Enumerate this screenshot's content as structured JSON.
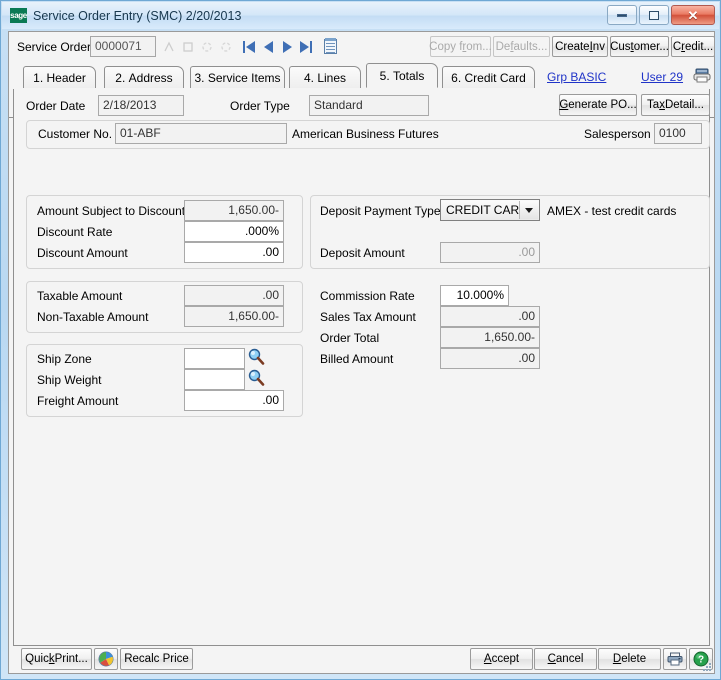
{
  "window": {
    "title": "Service Order Entry (SMC) 2/20/2013",
    "logo_text": "sage",
    "buttons": {
      "minimize": "minimize-button",
      "maximize": "maximize-button",
      "close": "close-button",
      "close_glyph": "✕"
    }
  },
  "toolbar": {
    "service_order_label": "Service Order",
    "service_order_value": "0000071",
    "nav": {
      "first": "first-record-icon",
      "prev": "previous-record-icon",
      "next": "next-record-icon",
      "last": "last-record-icon",
      "memo": "memo-icon"
    },
    "buttons": [
      {
        "label": "Copy from...",
        "mnemonic": "f",
        "enabled": false,
        "name": "copy-from-button"
      },
      {
        "label": "Defaults...",
        "mnemonic": "f",
        "enabled": false,
        "name": "defaults-button"
      },
      {
        "label": "Create Inv",
        "mnemonic": "I",
        "enabled": true,
        "name": "create-inv-button"
      },
      {
        "label": "Customer...",
        "mnemonic": "t",
        "enabled": true,
        "name": "customer-button"
      },
      {
        "label": "Credit...",
        "mnemonic": "r",
        "enabled": true,
        "name": "credit-button"
      }
    ]
  },
  "tabs": [
    {
      "num": "1.",
      "label": "Header",
      "active": false
    },
    {
      "num": "2.",
      "label": "Address",
      "active": false
    },
    {
      "num": "3.",
      "label": "Service Items",
      "active": false
    },
    {
      "num": "4.",
      "label": "Lines",
      "active": false
    },
    {
      "num": "5.",
      "label": "Totals",
      "active": true
    },
    {
      "num": "6.",
      "label": "Credit Card",
      "active": false
    }
  ],
  "links": {
    "group": "Grp BASIC",
    "user": "User 29"
  },
  "header": {
    "order_date_label": "Order Date",
    "order_date_value": "2/18/2013",
    "order_type_label": "Order Type",
    "order_type_value": "Standard",
    "generate_po_label": "Generate PO...",
    "tax_detail_label": "Tax Detail...",
    "customer_no_label": "Customer No.",
    "customer_no_value": "01-ABF",
    "customer_name": "American Business Futures",
    "salesperson_label": "Salesperson",
    "salesperson_value": "0100"
  },
  "discount_group": {
    "rows": [
      {
        "label": "Amount Subject to Discount",
        "value": "1,650.00-",
        "readonly": true
      },
      {
        "label": "Discount Rate",
        "value": ".000%",
        "readonly": false
      },
      {
        "label": "Discount Amount",
        "value": ".00",
        "readonly": false
      }
    ]
  },
  "tax_group": {
    "rows": [
      {
        "label": "Taxable Amount",
        "value": ".00",
        "readonly": true
      },
      {
        "label": "Non-Taxable Amount",
        "value": "1,650.00-",
        "readonly": true
      }
    ]
  },
  "ship_group": {
    "rows": [
      {
        "label": "Ship Zone",
        "value": "",
        "readonly": false,
        "lookup": true
      },
      {
        "label": "Ship Weight",
        "value": "",
        "readonly": false,
        "lookup": true
      },
      {
        "label": "Freight Amount",
        "value": ".00",
        "readonly": false,
        "lookup": false
      }
    ]
  },
  "deposit_group": {
    "payment_type_label": "Deposit Payment Type",
    "payment_type_value": "CREDIT CARD",
    "card_info": "AMEX  - test credit cards",
    "deposit_amount_label": "Deposit Amount",
    "deposit_amount_value": ".00"
  },
  "totals_group": {
    "rows": [
      {
        "label": "Commission Rate",
        "value": "10.000%",
        "readonly": false
      },
      {
        "label": "Sales Tax Amount",
        "value": ".00",
        "readonly": true
      },
      {
        "label": "Order Total",
        "value": "1,650.00-",
        "readonly": true
      },
      {
        "label": "Billed Amount",
        "value": ".00",
        "readonly": true
      }
    ]
  },
  "footer": {
    "quick_print": "Quick Print...",
    "recalc_price": "Recalc Price",
    "accept": "Accept",
    "cancel": "Cancel",
    "delete": "Delete",
    "print_icon": "printer-icon",
    "help_icon": "help-icon",
    "business_insights_icon": "business-insights-icon"
  }
}
